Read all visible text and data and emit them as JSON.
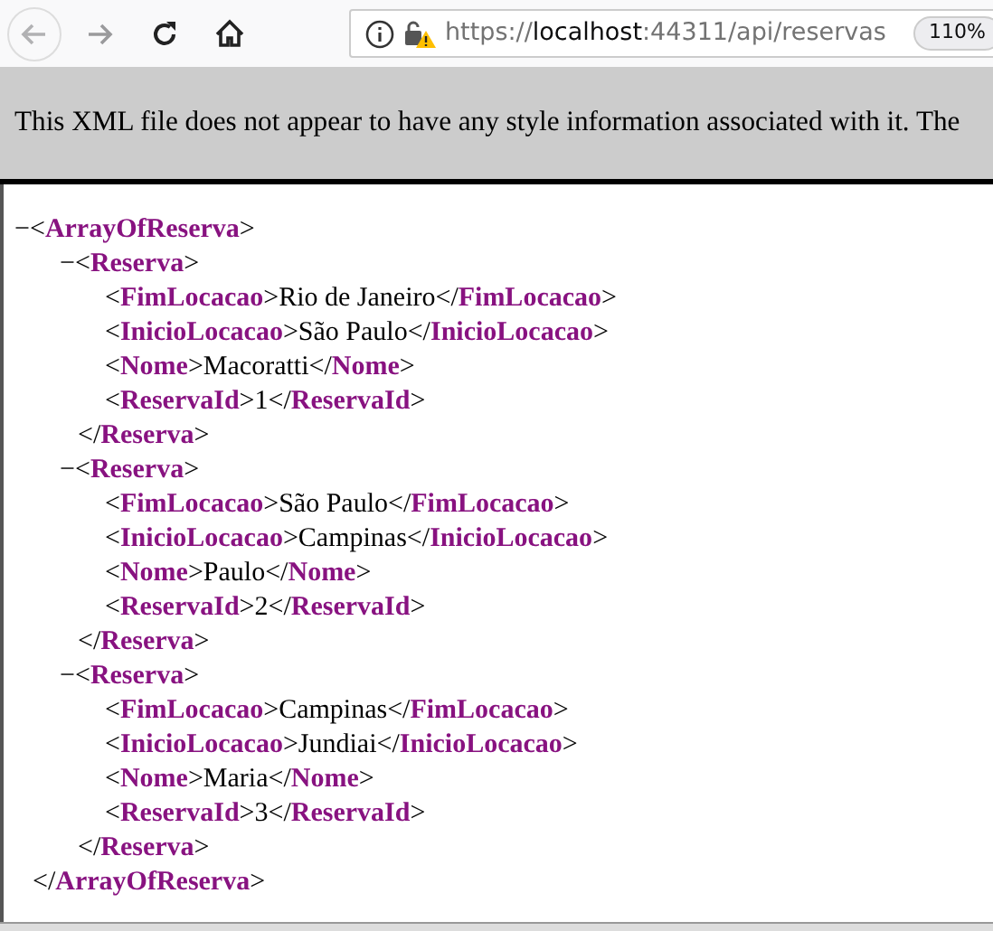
{
  "browser_toolbar": {
    "url": {
      "scheme": "https://",
      "host": "localhost",
      "path": ":44311/api/reservas"
    },
    "zoom": "110%"
  },
  "notice": "This XML file does not appear to have any style information associated with it. The",
  "xml": {
    "toggle": "−",
    "open": "<**ArrayOfReserva**>",
    "close": "</**ArrayOfReserva**>",
    "children": [
      {
        "toggle": "−",
        "open": "<**Reserva**>",
        "close": "</**Reserva**>",
        "children": [
          {
            "line": "<**FimLocacao**>Rio de Janeiro</**FimLocacao**>"
          },
          {
            "line": "<**InicioLocacao**>São Paulo</**InicioLocacao**>"
          },
          {
            "line": "<**Nome**>Macoratti</**Nome**>"
          },
          {
            "line": "<**ReservaId**>1</**ReservaId**>"
          }
        ]
      },
      {
        "toggle": "−",
        "open": "<**Reserva**>",
        "close": "</**Reserva**>",
        "children": [
          {
            "line": "<**FimLocacao**>São Paulo</**FimLocacao**>"
          },
          {
            "line": "<**InicioLocacao**>Campinas</**InicioLocacao**>"
          },
          {
            "line": "<**Nome**>Paulo</**Nome**>"
          },
          {
            "line": "<**ReservaId**>2</**ReservaId**>"
          }
        ]
      },
      {
        "toggle": "−",
        "open": "<**Reserva**>",
        "close": "</**Reserva**>",
        "children": [
          {
            "line": "<**FimLocacao**>Campinas</**FimLocacao**>"
          },
          {
            "line": "<**InicioLocacao**>Jundiai</**InicioLocacao**>"
          },
          {
            "line": "<**Nome**>Maria</**Nome**>"
          },
          {
            "line": "<**ReservaId**>3</**ReservaId**>"
          }
        ]
      }
    ]
  }
}
